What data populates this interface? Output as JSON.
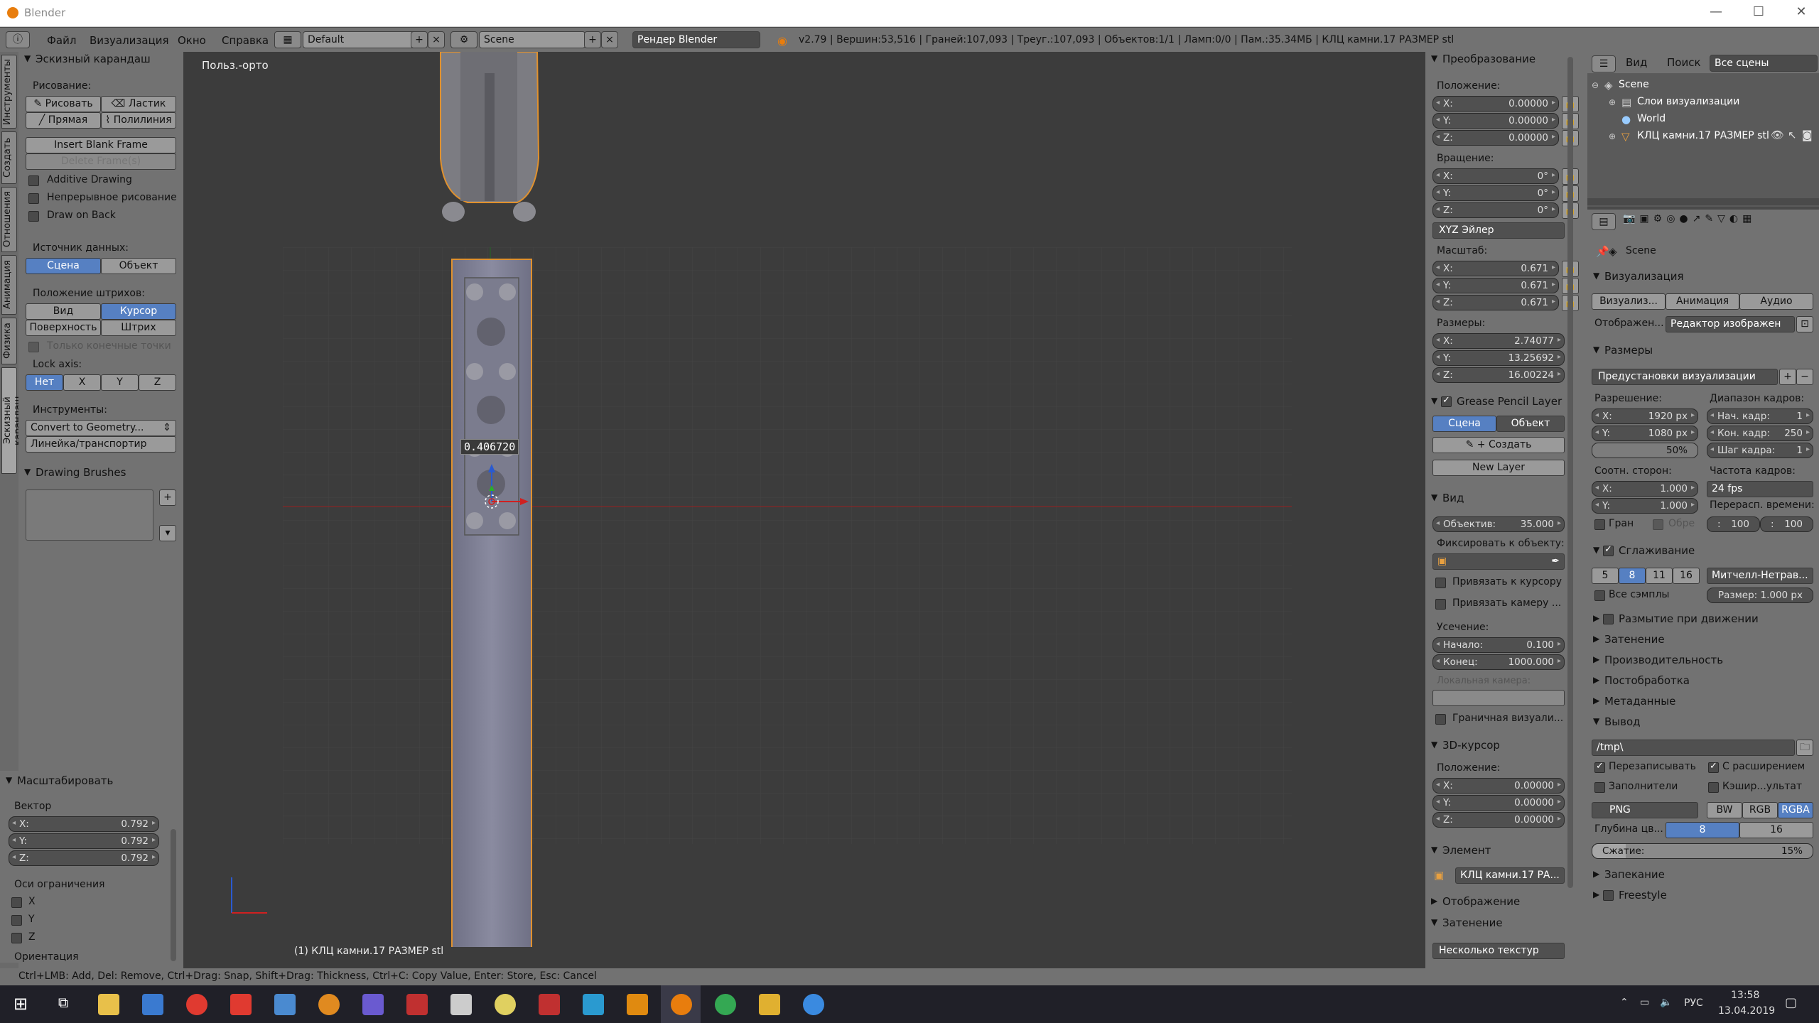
{
  "window": {
    "title": "Blender",
    "min": "—",
    "max": "☐",
    "close": "✕"
  },
  "menu": {
    "items": [
      "Файл",
      "Визуализация",
      "Окно",
      "Справка"
    ],
    "layout": "Default",
    "scene": "Scene",
    "engine": "Рендер Blender",
    "status": "v2.79 | Вершин:53,516 | Граней:107,093 | Треуг.:107,093 | Объектов:1/1 | Ламп:0/0 | Пам.:35.34МБ | КЛЦ камни.17 РАЗМЕР stl"
  },
  "tabs": [
    "Инструменты",
    "Создать",
    "Отношения",
    "Анимация",
    "Физика",
    "Эскизный карандаш"
  ],
  "tools": {
    "header": "Эскизный карандаш",
    "drawing_label": "Рисование:",
    "draw": "Рисовать",
    "eraser": "Ластик",
    "line": "Прямая",
    "poly": "Полилиния",
    "insert_frame": "Insert Blank Frame",
    "delete_frame": "Delete Frame(s)",
    "additive": "Additive Drawing",
    "continuous": "Непрерывное рисование",
    "draw_on_back": "Draw on Back",
    "source_label": "Источник данных:",
    "scene": "Сцена",
    "object": "Объект",
    "placement_label": "Положение штрихов:",
    "view": "Вид",
    "cursor": "Курсор",
    "surface": "Поверхность",
    "stroke": "Штрих",
    "endpoints": "Только конечные точки",
    "lock_label": "Lock axis:",
    "lock": [
      "Нет",
      "X",
      "Y",
      "Z"
    ],
    "instruments_label": "Инструменты:",
    "convert": "Convert to Geometry...",
    "ruler": "Линейка/транспортир",
    "brushes_header": "Drawing Brushes"
  },
  "operator": {
    "header": "Масштабировать",
    "vector_label": "Вектор",
    "x": "0.792",
    "y": "0.792",
    "z": "0.792",
    "constraint_label": "Оси ограничения",
    "axes": [
      "X",
      "Y",
      "Z"
    ],
    "orientation_label": "Ориентация"
  },
  "viewport": {
    "view_name": "Польз.-орто",
    "value_readout": "0.406720",
    "object_label": "(1) КЛЦ камни.17 РАЗМЕР stl"
  },
  "transform": {
    "header": "Преобразование",
    "location_label": "Положение:",
    "loc": [
      "0.00000",
      "0.00000",
      "0.00000"
    ],
    "rotation_label": "Вращение:",
    "rot": [
      "0°",
      "0°",
      "0°"
    ],
    "rotmode": "XYZ Эйлер",
    "scale_label": "Масштаб:",
    "scale": [
      "0.671",
      "0.671",
      "0.671"
    ],
    "dims_label": "Размеры:",
    "dims": [
      "2.74077",
      "13.25692",
      "16.00224"
    ],
    "gp_header": "Grease Pencil Layer",
    "gp_scene": "Сцена",
    "gp_object": "Объект",
    "gp_create": "Создать",
    "new_layer": "New Layer",
    "view_header": "Вид",
    "lens_label": "Объектив:",
    "lens": "35.000",
    "lock_obj_label": "Фиксировать к объекту:",
    "lock_cursor": "Привязать к курсору",
    "lock_camera": "Привязать камеру ...",
    "clip_label": "Усечение:",
    "clip_start_label": "Начало:",
    "clip_start": "0.100",
    "clip_end_label": "Конец:",
    "clip_end": "1000.000",
    "local_cam": "Локальная камера:",
    "border": "Граничная визуали...",
    "cursor_header": "3D-курсор",
    "cursor_loc_label": "Положение:",
    "cursor_loc": [
      "0.00000",
      "0.00000",
      "0.00000"
    ],
    "item_header": "Элемент",
    "item_name": "КЛЦ камни.17 РА...",
    "display_header": "Отображение",
    "shading_header": "Затенение",
    "shading_mode": "Несколько текстур"
  },
  "outliner": {
    "view": "Вид",
    "search": "Поиск",
    "all": "Все сцены",
    "scene": "Scene",
    "render_layers": "Слои визуализации",
    "world": "World",
    "object": "КЛЦ камни.17 РАЗМЕР stl"
  },
  "props": {
    "scene": "Scene",
    "render_header": "Визуализация",
    "render_btn": "Визуализ...",
    "anim_btn": "Анимация",
    "audio_btn": "Аудио",
    "display_label": "Отображен...",
    "display_val": "Редактор изображен",
    "dims_header": "Размеры",
    "presets": "Предустановки визуализации",
    "res_label": "Разрешение:",
    "res_x": "1920 px",
    "res_y": "1080 px",
    "res_pct": "50%",
    "frame_range_label": "Диапазон кадров:",
    "start_label": "Нач. кадр:",
    "start": "1",
    "end_label": "Кон. кадр:",
    "end": "250",
    "step_label": "Шаг кадра:",
    "step": "1",
    "aspect_label": "Соотн. сторон:",
    "asp_x": "1.000",
    "asp_y": "1.000",
    "fps_label": "Частота кадров:",
    "fps": "24 fps",
    "remap_label": "Перерасп. времени:",
    "remap_old": "100",
    "remap_new": "100",
    "border": "Гран",
    "crop": "Обре",
    "aa_header": "Сглаживание",
    "aa": [
      "5",
      "8",
      "11",
      "16"
    ],
    "aa_filter": "Митчелл-Нетрав...",
    "all_samples": "Все сэмплы",
    "filter_size": "Размер: 1.000 px",
    "motion_blur": "Размытие при движении",
    "shading": "Затенение",
    "performance": "Производительность",
    "post": "Постобработка",
    "metadata": "Метаданные",
    "output_header": "Вывод",
    "output_path": "/tmp\\",
    "overwrite": "Перезаписывать",
    "extensions": "С расширением",
    "placeholders": "Заполнители",
    "cache": "Кэшир...ультат",
    "format": "PNG",
    "bw": "BW",
    "rgb": "RGB",
    "rgba": "RGBA",
    "depth_label": "Глубина цв...",
    "depth8": "8",
    "depth16": "16",
    "compression": "Сжатие:",
    "compression_val": "15%",
    "bake": "Запекание",
    "freestyle": "Freestyle"
  },
  "footer": {
    "hint": "Ctrl+LMB: Add, Del: Remove, Ctrl+Drag: Snap, Shift+Drag: Thickness, Ctrl+C: Copy Value, Enter: Store,  Esc: Cancel"
  },
  "taskbar": {
    "lang": "РУС",
    "time": "13:58",
    "date": "13.04.2019"
  }
}
